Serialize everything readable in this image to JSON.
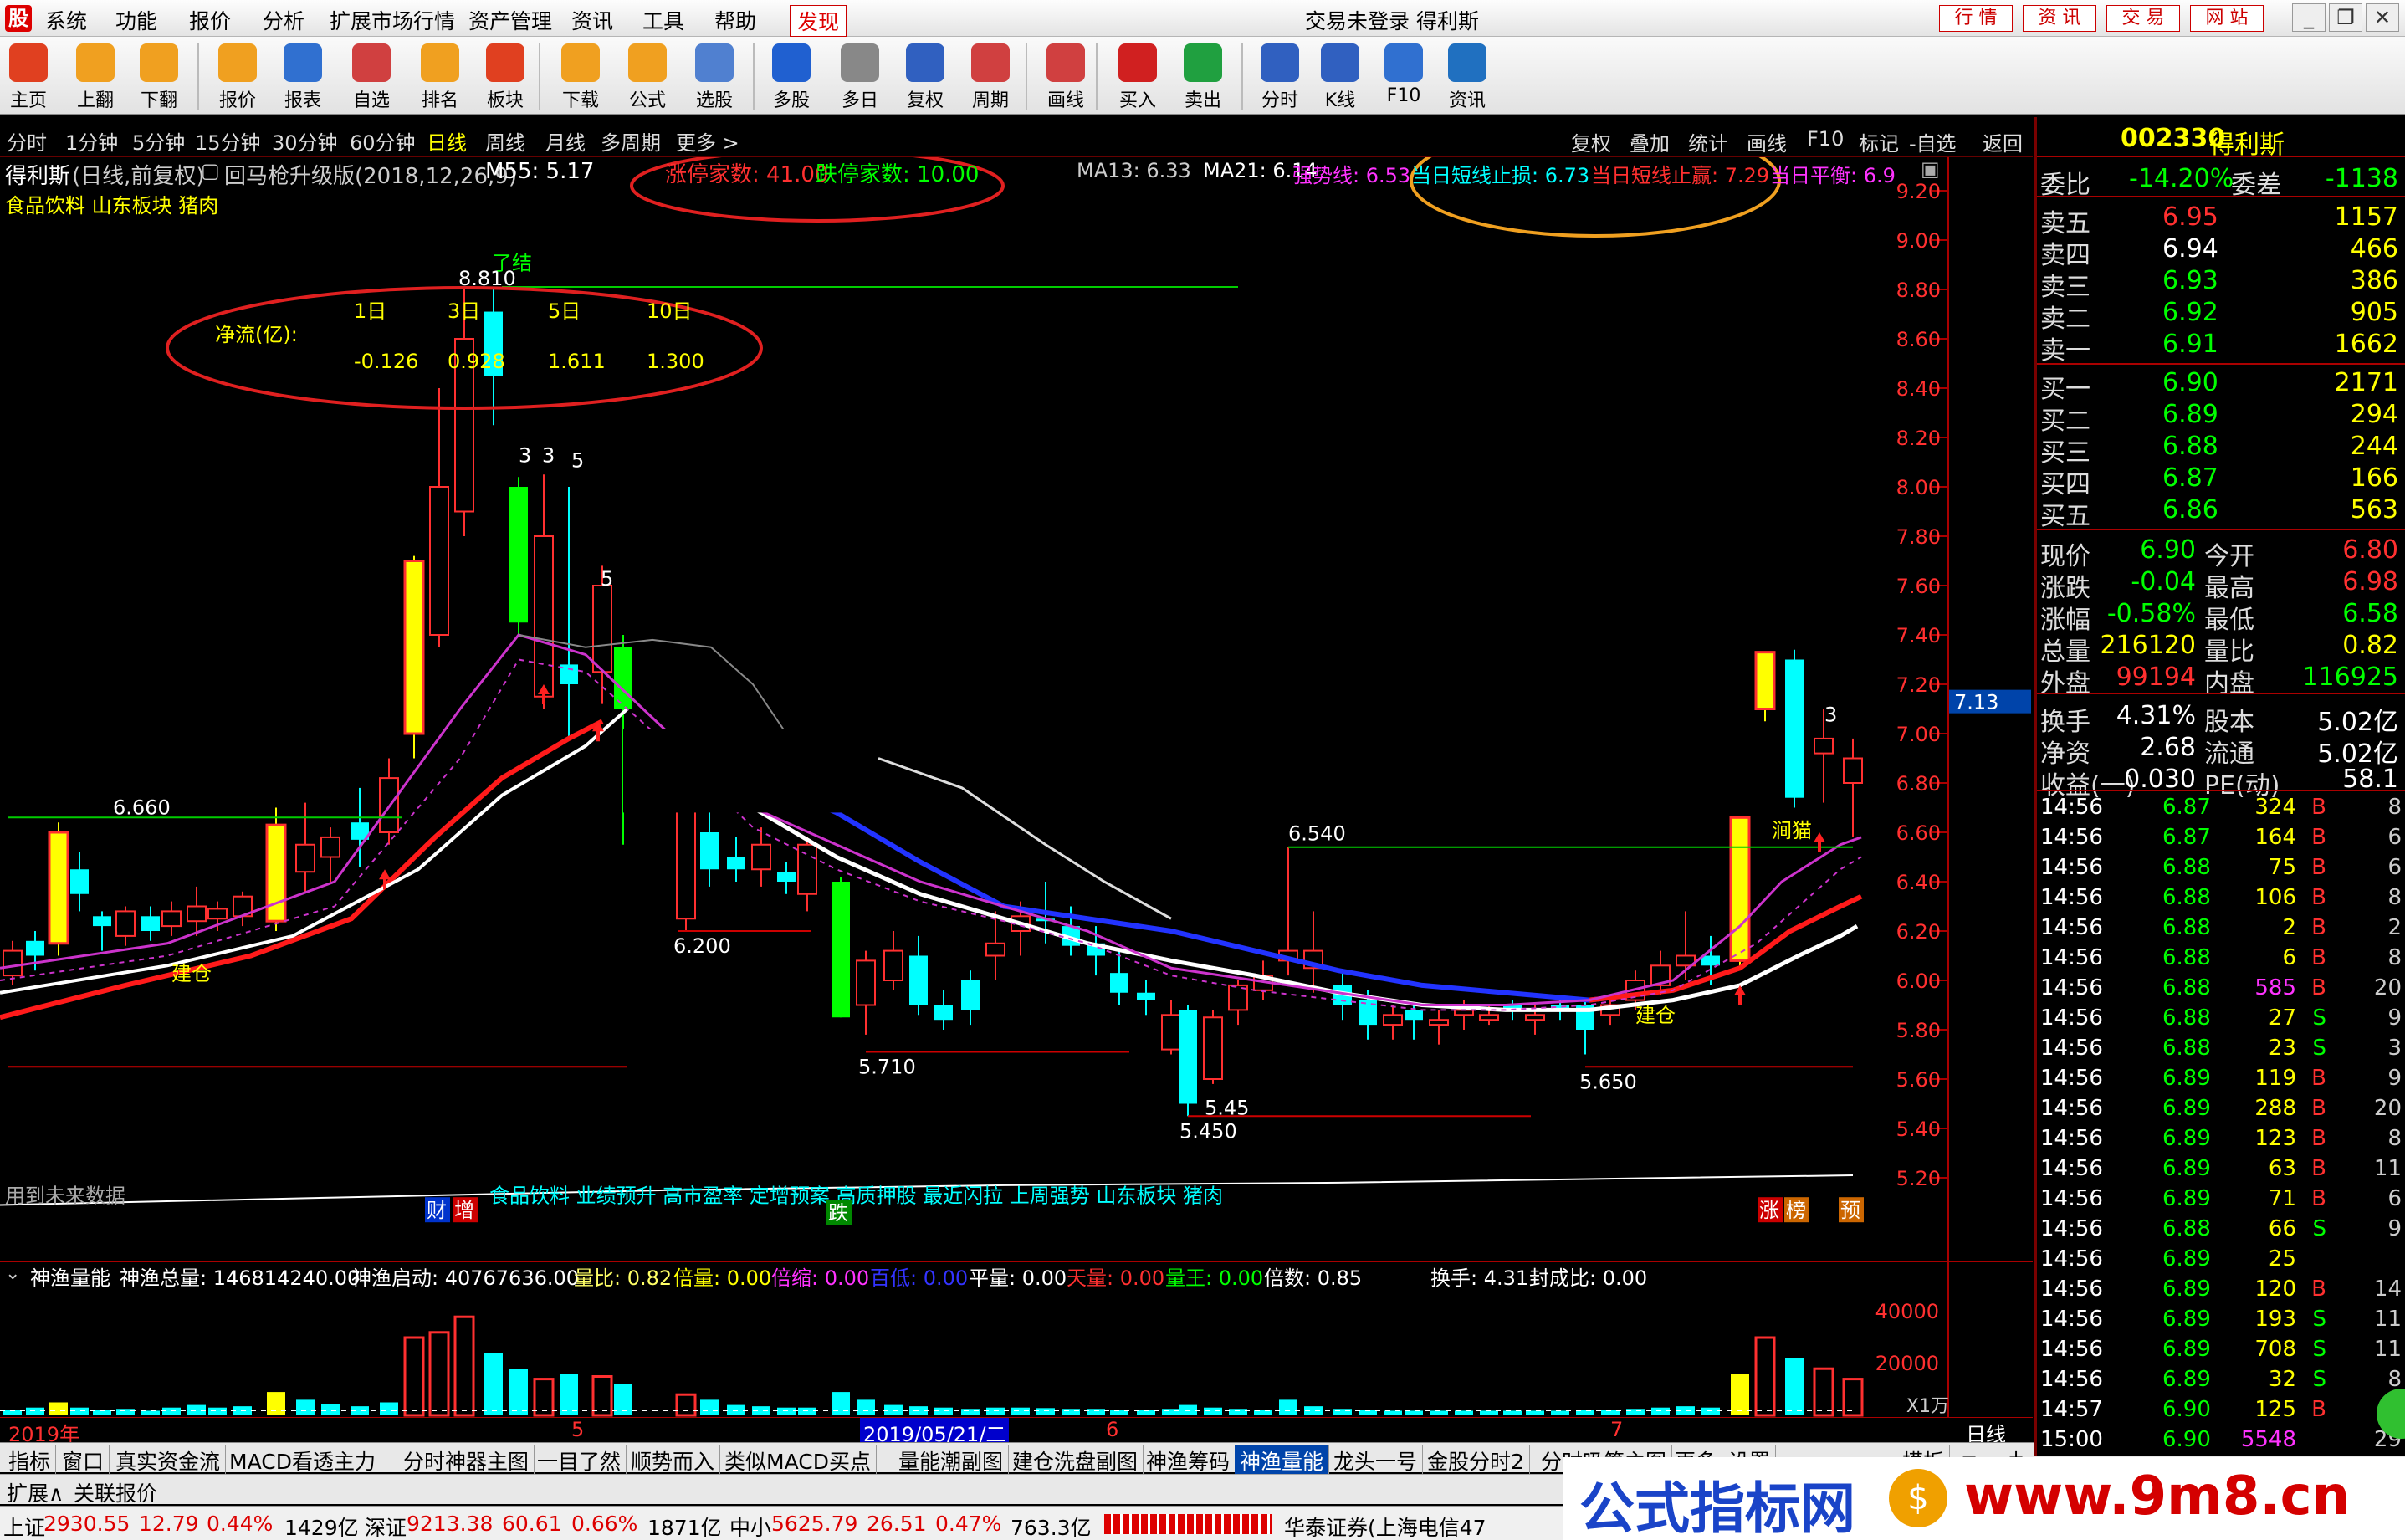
{
  "menubar": {
    "items": [
      "系统",
      "功能",
      "报价",
      "分析",
      "扩展市场行情",
      "资产管理",
      "资讯",
      "工具",
      "帮助",
      "发现"
    ],
    "center_title": "交易未登录 得利斯",
    "right_buttons": [
      "行 情",
      "资 讯",
      "交 易",
      "网 站"
    ]
  },
  "toolbar": {
    "buttons": [
      {
        "label": "主页",
        "icon": "home-icon"
      },
      {
        "label": "上翻",
        "icon": "arrow-up-icon"
      },
      {
        "label": "下翻",
        "icon": "arrow-down-icon"
      },
      {
        "label": "报价",
        "icon": "yen-icon"
      },
      {
        "label": "报表",
        "icon": "report-icon"
      },
      {
        "label": "自选",
        "icon": "f6-icon"
      },
      {
        "label": "排名",
        "icon": "rank-icon"
      },
      {
        "label": "板块",
        "icon": "grid-icon"
      },
      {
        "label": "下载",
        "icon": "download-icon"
      },
      {
        "label": "公式",
        "icon": "formula-icon"
      },
      {
        "label": "选股",
        "icon": "pick-stock-icon"
      },
      {
        "label": "多股",
        "icon": "multi-stock-icon"
      },
      {
        "label": "多日",
        "icon": "clock-icon"
      },
      {
        "label": "复权",
        "icon": "restore-icon"
      },
      {
        "label": "周期",
        "icon": "f8-icon"
      },
      {
        "label": "画线",
        "icon": "draw-icon"
      },
      {
        "label": "买入",
        "icon": "buy-icon"
      },
      {
        "label": "卖出",
        "icon": "sell-icon"
      },
      {
        "label": "分时",
        "icon": "intraday-icon"
      },
      {
        "label": "K线",
        "icon": "kline-icon"
      },
      {
        "label": "F10",
        "icon": "f10-icon"
      },
      {
        "label": "资讯",
        "icon": "news-icon"
      }
    ]
  },
  "periods": [
    "分时",
    "1分钟",
    "5分钟",
    "15分钟",
    "30分钟",
    "60分钟",
    "日线",
    "周线",
    "月线",
    "多周期",
    "更多 >"
  ],
  "chart_tools": [
    "复权",
    "叠加",
    "统计",
    "画线",
    "F10",
    "标记",
    "-自选",
    "返回"
  ],
  "header": {
    "stock_name": "得利斯",
    "period_label": "(日线,前复权)",
    "indicator": "回马枪升级版(2018,12,26,9)",
    "m55": "M55: 5.17",
    "limit_up": "涨停家数: 41.00",
    "limit_down": "跌停家数: 10.00",
    "ma13": "MA13: 6.33",
    "ma21": "MA21: 6.14",
    "strong": "强势线: 6.53",
    "stop_loss": "当日短线止损: 6.73",
    "stop_profit": "当日短线止赢: 7.29",
    "balance": "当日平衡: 6.9",
    "concepts": "食品饮料 山东板块 猪肉"
  },
  "netflow": {
    "label": "净流(亿):",
    "cols": [
      "1日",
      "3日",
      "5日",
      "10日"
    ],
    "values": [
      "-0.126",
      "0.928",
      "1.611",
      "1.300"
    ]
  },
  "annotations": {
    "high": "8.810",
    "lvl_6660": "6.660",
    "lvl_6200": "6.200",
    "lvl_5710": "5.710",
    "lvl_5450": "5.450",
    "lvl_545": "5.45",
    "lvl_6540": "6.540",
    "lvl_5650": "5.650",
    "jiancang1": "建仓",
    "jiancang2": "建仓",
    "liaojie": "了结",
    "three1": "3",
    "three2": "3",
    "five1": "5",
    "five2": "5",
    "three3": "3",
    "chuangtou": "涧猫",
    "price_tag": "7.13",
    "future_data": "用到未来数据",
    "concept_strip": "食品饮料 业绩预升 高市盈率 定增预案 高质押股 最近闪拉 上周强势 山东板块 猪肉",
    "badge_cai": "财",
    "badge_zeng": "增",
    "badge_die": "跌",
    "badge_zhang": "涨",
    "badge_bang": "榜",
    "badge_yu": "预"
  },
  "price_axis": [
    "9.20",
    "9.00",
    "8.80",
    "8.60",
    "8.40",
    "8.20",
    "8.00",
    "7.80",
    "7.60",
    "7.40",
    "7.20",
    "7.00",
    "6.80",
    "6.60",
    "6.40",
    "6.20",
    "6.00",
    "5.80",
    "5.60",
    "5.40",
    "5.20"
  ],
  "volume": {
    "title": "神渔量能",
    "total": "神渔总量: 146814240.00",
    "start": "神渔启动: 40767636.00",
    "liangbi": "量比: 0.82",
    "beiliang": "倍量: 0.00",
    "beisuo": "倍缩: 0.00",
    "bailiang": "百低: 0.00",
    "pingliang": "平量: 0.00",
    "tianliang": "天量: 0.00",
    "liangwang": "量王: 0.00",
    "beishu": "倍数: 0.85",
    "huanshou": "换手: 4.31",
    "fengcheng": "封成比: 0.00",
    "axis": [
      "40000",
      "20000"
    ],
    "unit": "X1万"
  },
  "date_axis": {
    "start": "2019年",
    "m5": "5",
    "cursor": "2019/05/21/二",
    "m6": "6",
    "m7": "7",
    "mode": "日线"
  },
  "tabs": [
    "指标",
    "窗口",
    "真实资金流",
    "MACD看透主力",
    "分时神器主图",
    "一目了然",
    "顺势而入",
    "类似MACD买点",
    "量能潮副图",
    "建仓洗盘副图",
    "神渔筹码",
    "神渔量能",
    "龙头一号",
    "金股分时2",
    "分时吸筹主图",
    "更多",
    "设置"
  ],
  "tabs_right": "模板",
  "tabs2": [
    "扩展∧",
    "关联报价"
  ],
  "quote": {
    "code": "002330",
    "name": "得利斯",
    "weibi_label": "委比",
    "weibi": "-14.20%",
    "weicha_label": "委差",
    "weicha": "-1138",
    "asks": [
      {
        "label": "卖五",
        "price": "6.95",
        "vol": "1157"
      },
      {
        "label": "卖四",
        "price": "6.94",
        "vol": "466"
      },
      {
        "label": "卖三",
        "price": "6.93",
        "vol": "386"
      },
      {
        "label": "卖二",
        "price": "6.92",
        "vol": "905"
      },
      {
        "label": "卖一",
        "price": "6.91",
        "vol": "1662"
      }
    ],
    "bids": [
      {
        "label": "买一",
        "price": "6.90",
        "vol": "2171"
      },
      {
        "label": "买二",
        "price": "6.89",
        "vol": "294"
      },
      {
        "label": "买三",
        "price": "6.88",
        "vol": "244"
      },
      {
        "label": "买四",
        "price": "6.87",
        "vol": "166"
      },
      {
        "label": "买五",
        "price": "6.86",
        "vol": "563"
      }
    ],
    "stats": [
      {
        "l1": "现价",
        "v1": "6.90",
        "l2": "今开",
        "v2": "6.80"
      },
      {
        "l1": "涨跌",
        "v1": "-0.04",
        "l2": "最高",
        "v2": "6.98"
      },
      {
        "l1": "涨幅",
        "v1": "-0.58%",
        "l2": "最低",
        "v2": "6.58"
      },
      {
        "l1": "总量",
        "v1": "216120",
        "l2": "量比",
        "v2": "0.82"
      },
      {
        "l1": "外盘",
        "v1": "99194",
        "l2": "内盘",
        "v2": "116925"
      },
      {
        "l1": "换手",
        "v1": "4.31%",
        "l2": "股本",
        "v2": "5.02亿"
      },
      {
        "l1": "净资",
        "v1": "2.68",
        "l2": "流通",
        "v2": "5.02亿"
      },
      {
        "l1": "收益(一)",
        "v1": "0.030",
        "l2": "PE(动)",
        "v2": "58.1"
      }
    ]
  },
  "ticks": [
    [
      "14:56",
      "6.87",
      "324",
      "B",
      "8"
    ],
    [
      "14:56",
      "6.87",
      "164",
      "B",
      "6"
    ],
    [
      "14:56",
      "6.88",
      "75",
      "B",
      "6"
    ],
    [
      "14:56",
      "6.88",
      "106",
      "B",
      "8"
    ],
    [
      "14:56",
      "6.88",
      "2",
      "B",
      "2"
    ],
    [
      "14:56",
      "6.88",
      "6",
      "B",
      "8"
    ],
    [
      "14:56",
      "6.88",
      "585",
      "B",
      "20"
    ],
    [
      "14:56",
      "6.88",
      "27",
      "S",
      "9"
    ],
    [
      "14:56",
      "6.88",
      "23",
      "S",
      "3"
    ],
    [
      "14:56",
      "6.89",
      "119",
      "B",
      "9"
    ],
    [
      "14:56",
      "6.89",
      "288",
      "B",
      "20"
    ],
    [
      "14:56",
      "6.89",
      "123",
      "B",
      "8"
    ],
    [
      "14:56",
      "6.89",
      "63",
      "B",
      "11"
    ],
    [
      "14:56",
      "6.89",
      "71",
      "B",
      "6"
    ],
    [
      "14:56",
      "6.88",
      "66",
      "S",
      "9"
    ],
    [
      "14:56",
      "6.89",
      "25",
      "",
      ""
    ],
    [
      "14:56",
      "6.89",
      "120",
      "B",
      "14"
    ],
    [
      "14:56",
      "6.89",
      "193",
      "S",
      "11"
    ],
    [
      "14:56",
      "6.89",
      "708",
      "S",
      "11"
    ],
    [
      "14:56",
      "6.89",
      "32",
      "S",
      "8"
    ],
    [
      "14:57",
      "6.90",
      "125",
      "B",
      "8"
    ],
    [
      "15:00",
      "6.90",
      "5548",
      "",
      "29"
    ]
  ],
  "statusbar": {
    "sh_label": "上证",
    "sh": "2930.55",
    "sh_chg": "12.79",
    "sh_pct": "0.44%",
    "sh_amt": "1429亿",
    "sz_label": "深证",
    "sz": "9213.38",
    "sz_chg": "60.61",
    "sz_pct": "0.66%",
    "sz_amt": "1871亿",
    "zx_label": "中小",
    "zx": "5625.79",
    "zx_chg": "26.51",
    "zx_pct": "0.47%",
    "zx_amt": "763.3亿",
    "broker": "华泰证券(上海电信47"
  },
  "watermark": {
    "cn": "公式指标网",
    "url": "www.9m8.cn"
  },
  "colors": {
    "up": "#ff3030",
    "down": "#00ffff",
    "green": "#00ff00",
    "yellow": "#ffff00",
    "accent_red": "#ff0000"
  }
}
